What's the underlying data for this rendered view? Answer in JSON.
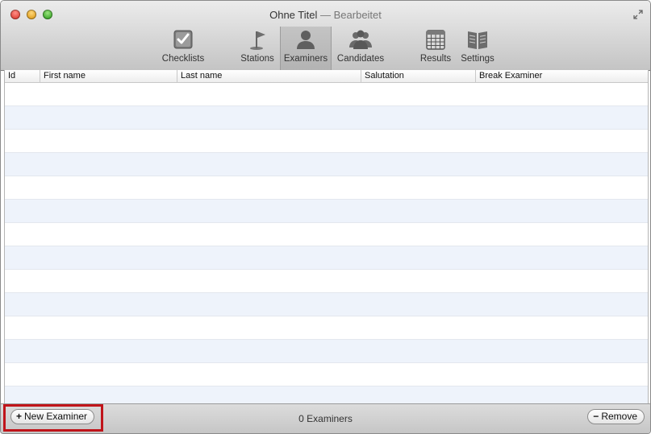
{
  "window": {
    "title": "Ohne Titel",
    "separator": "—",
    "status": "Bearbeitet"
  },
  "toolbar": {
    "selected": "Examiners",
    "items": [
      {
        "label": "Checklists",
        "icon": "checkbox-icon"
      },
      {
        "label": "Stations",
        "icon": "flag-icon"
      },
      {
        "label": "Examiners",
        "icon": "person-icon"
      },
      {
        "label": "Candidates",
        "icon": "group-icon"
      },
      {
        "label": "Results",
        "icon": "table-grid-icon"
      },
      {
        "label": "Settings",
        "icon": "book-icon"
      }
    ]
  },
  "table": {
    "columns": [
      "Id",
      "First name",
      "Last name",
      "Salutation",
      "Break Examiner"
    ],
    "rows": []
  },
  "bottombar": {
    "new_button": {
      "symbol": "+",
      "label": "New Examiner"
    },
    "count_label": "0 Examiners",
    "remove_button": {
      "symbol": "−",
      "label": "Remove"
    }
  },
  "colors": {
    "highlight": "#c0141a",
    "row_alt": "#eef3fb"
  }
}
